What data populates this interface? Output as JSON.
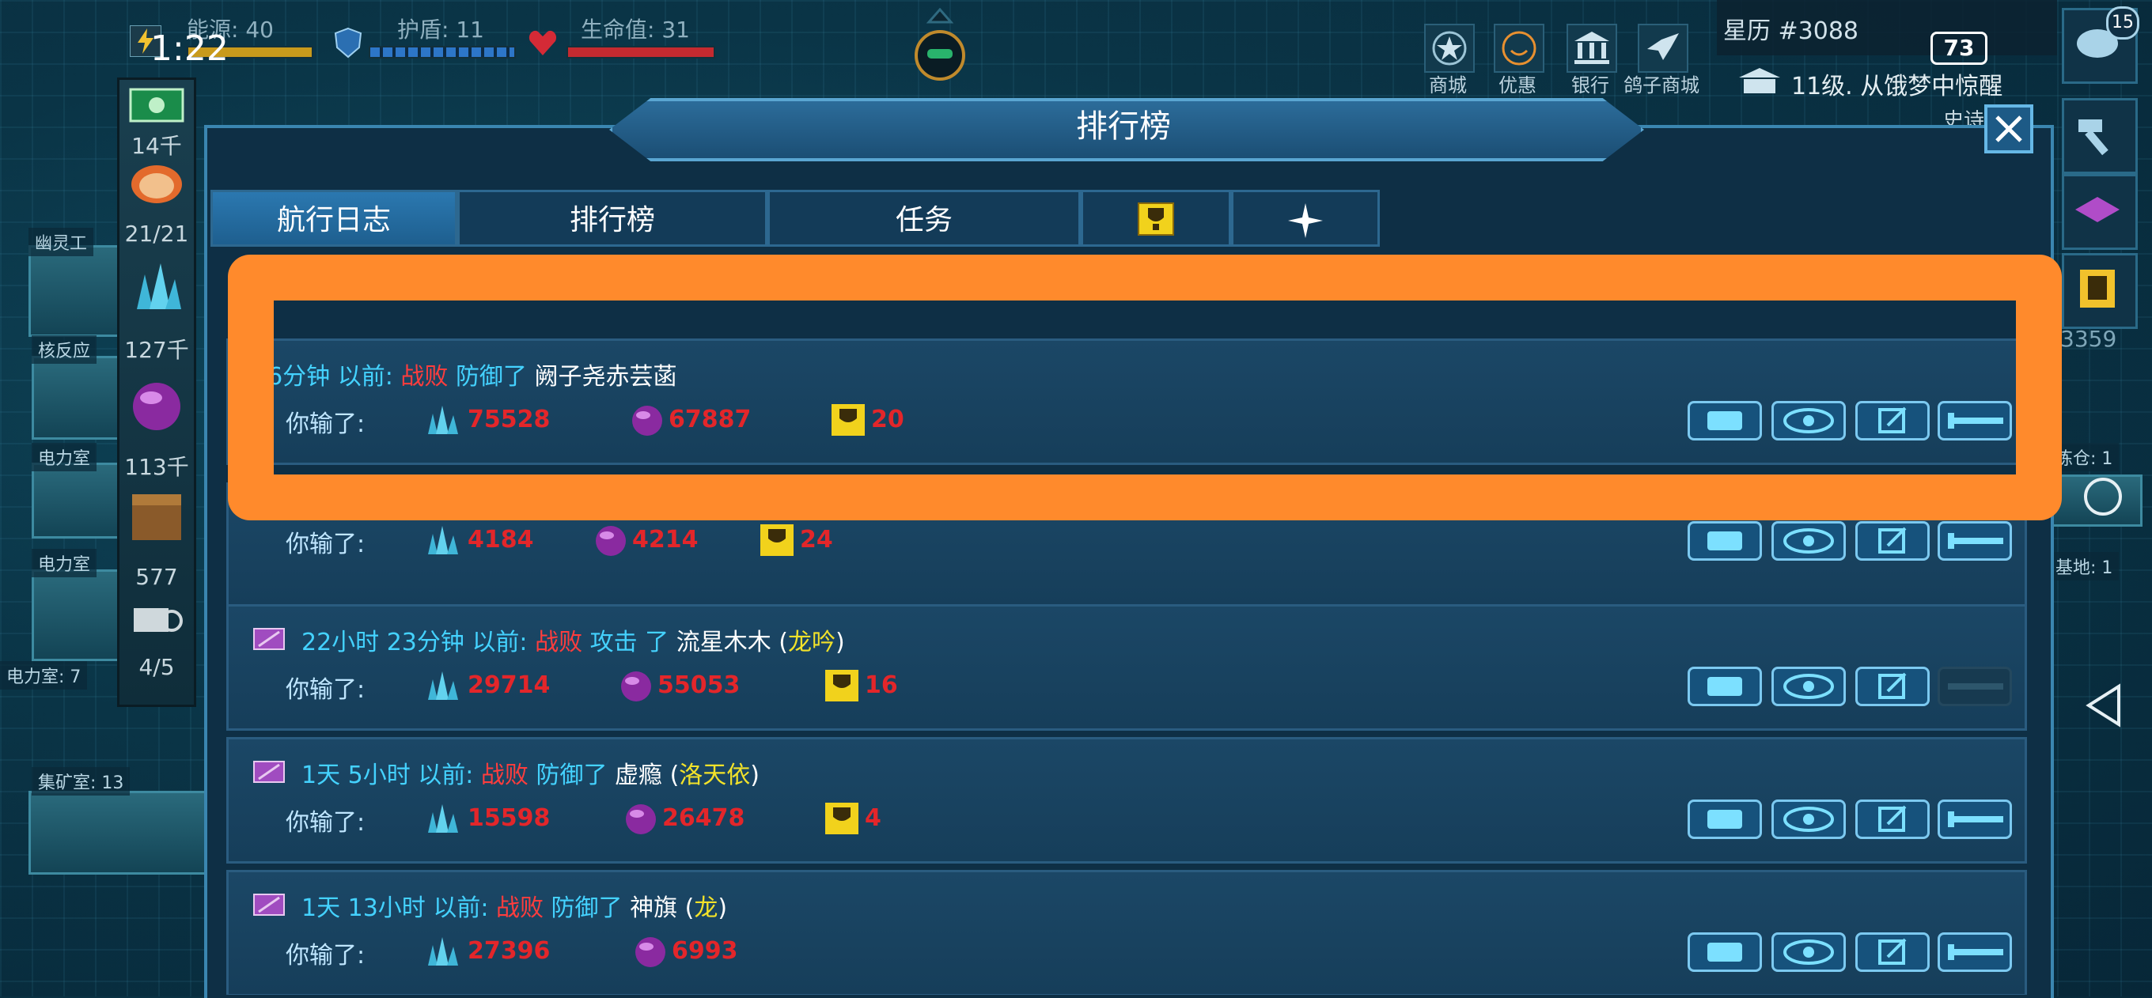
{
  "hud": {
    "energy": "能源: 40",
    "shield": "护盾: 11",
    "health": "生命值: 31",
    "clock": "1:22",
    "stardate": "星历 #3088",
    "level": "11级. 从饿梦中惊醒",
    "battery": "73",
    "notif_count": "15",
    "right_count": "3359",
    "right_partial": "史诗"
  },
  "top_icons": [
    {
      "label": "商城",
      "icon": "star-icon"
    },
    {
      "label": "优惠",
      "icon": "smile-icon"
    },
    {
      "label": "银行",
      "icon": "bank-icon"
    },
    {
      "label": "鸽子商城",
      "icon": "pigeon-icon"
    }
  ],
  "resources": {
    "credits": "14千",
    "crew": "21/21",
    "crystal": "127千",
    "orb": "113千",
    "box": "577",
    "drones": "4/5"
  },
  "rooms": {
    "ghost": "幽灵工",
    "reactor": "核反应",
    "power1": "电力室",
    "power2": "电力室",
    "power3": "电力室: 7",
    "mining": "集矿室: 13",
    "refinery": "炼仓: 1",
    "base": "基地: 1"
  },
  "panel": {
    "title": "排行榜",
    "tabs": [
      "航行日志",
      "排行榜",
      "任务"
    ]
  },
  "entries": [
    {
      "time": "16分钟",
      "before": "以前:",
      "result": "战败",
      "action": "防御了",
      "opponent": "阙子尧赤芸菡",
      "guild": "",
      "lost": "你输了:",
      "crystal": "75528",
      "orb": "67887",
      "trophy": "20"
    },
    {
      "time": "",
      "before": "",
      "result": "",
      "action": "",
      "opponent": "",
      "guild": "",
      "lost": "你输了:",
      "crystal": "4184",
      "orb": "4214",
      "trophy": "24"
    },
    {
      "time": "22小时 23分钟",
      "before": "以前:",
      "result": "战败",
      "action": "攻击 了",
      "opponent": "流星木木",
      "guild": "龙吟",
      "lost": "你输了:",
      "crystal": "29714",
      "orb": "55053",
      "trophy": "16"
    },
    {
      "time": "1天 5小时",
      "before": "以前:",
      "result": "战败",
      "action": "防御了",
      "opponent": "虚瘾",
      "guild": "洛天依",
      "lost": "你输了:",
      "crystal": "15598",
      "orb": "26478",
      "trophy": "4"
    },
    {
      "time": "1天 13小时",
      "before": "以前:",
      "result": "战败",
      "action": "防御了",
      "opponent": "神旗",
      "guild": "龙",
      "lost": "你输了:",
      "crystal": "27396",
      "orb": "6993",
      "trophy": ""
    }
  ],
  "colors": {
    "highlight": "#ff8a2c",
    "time_cyan": "#44d2ff",
    "defeat_red": "#ff3d3d",
    "number_red": "#e3262a",
    "guild_yellow": "#f2e22a"
  }
}
